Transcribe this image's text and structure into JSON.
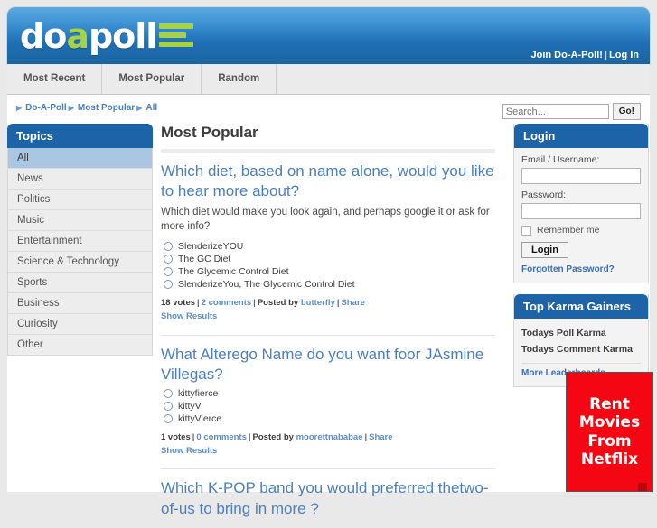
{
  "site": {
    "logo_text_a": "do",
    "logo_accent": "a",
    "logo_text_b": "poll",
    "brand_green": "#a6d24a",
    "brand_blue": "#1d63a8"
  },
  "header": {
    "join_label": "Join Do-A-Poll!",
    "separator": "|",
    "login_label": "Log In"
  },
  "nav": {
    "items": [
      {
        "label": "Most Recent"
      },
      {
        "label": "Most Popular"
      },
      {
        "label": "Random"
      }
    ]
  },
  "breadcrumb": {
    "items": [
      {
        "label": "Do-A-Poll"
      },
      {
        "label": "Most Popular"
      },
      {
        "label": "All"
      }
    ]
  },
  "search": {
    "placeholder": "Search...",
    "value": "",
    "button_label": "Go!"
  },
  "sidebar": {
    "title": "Topics",
    "items": [
      {
        "label": "All",
        "active": true
      },
      {
        "label": "News",
        "active": false
      },
      {
        "label": "Politics",
        "active": false
      },
      {
        "label": "Music",
        "active": false
      },
      {
        "label": "Entertainment",
        "active": false
      },
      {
        "label": "Science & Technology",
        "active": false
      },
      {
        "label": "Sports",
        "active": false
      },
      {
        "label": "Business",
        "active": false
      },
      {
        "label": "Curiosity",
        "active": false
      },
      {
        "label": "Other",
        "active": false
      }
    ]
  },
  "main": {
    "page_title": "Most Popular",
    "polls": [
      {
        "title": "Which diet, based on name alone, would you like to hear more about?",
        "description": "Which diet would make you look again, and perhaps google it or ask for more info?",
        "options": [
          "SlenderizeYOU",
          "The GC Diet",
          "The Glycemic Control Diet",
          "SlenderizeYou, The Glycemic Control Diet"
        ],
        "votes": "18 votes",
        "comments": "2 comments",
        "posted_by_label": "Posted by",
        "author": "butterfly",
        "share": "Share",
        "show_results": "Show Results"
      },
      {
        "title": "What Alterego Name do you want foor JAsmine Villegas?",
        "description": "",
        "options": [
          "kittyfierce",
          "kittyV",
          "kittyVierce"
        ],
        "votes": "1 votes",
        "comments": "0 comments",
        "posted_by_label": "Posted by",
        "author": "moorettnababae",
        "share": "Share",
        "show_results": "Show Results"
      },
      {
        "title": "Which K-POP band you would preferred thetwo-of-us to bring in more ?",
        "description": "",
        "options": [],
        "votes": "",
        "comments": "",
        "posted_by_label": "",
        "author": "",
        "share": "",
        "show_results": ""
      }
    ]
  },
  "login_box": {
    "title": "Login",
    "email_label": "Email / Username:",
    "email_value": "",
    "password_label": "Password:",
    "password_value": "",
    "remember_label": "Remember me",
    "button_label": "Login",
    "forgot_label": "Forgotten Password?"
  },
  "karma_box": {
    "title": "Top Karma Gainers",
    "items": [
      {
        "label": "Todays Poll Karma"
      },
      {
        "label": "Todays Comment Karma"
      }
    ],
    "more_label": "More Leaderboards..."
  },
  "ad": {
    "line1": "Rent",
    "line2": "Movies",
    "line3": "From",
    "line4": "Netflix",
    "bg_color": "#f40612"
  }
}
